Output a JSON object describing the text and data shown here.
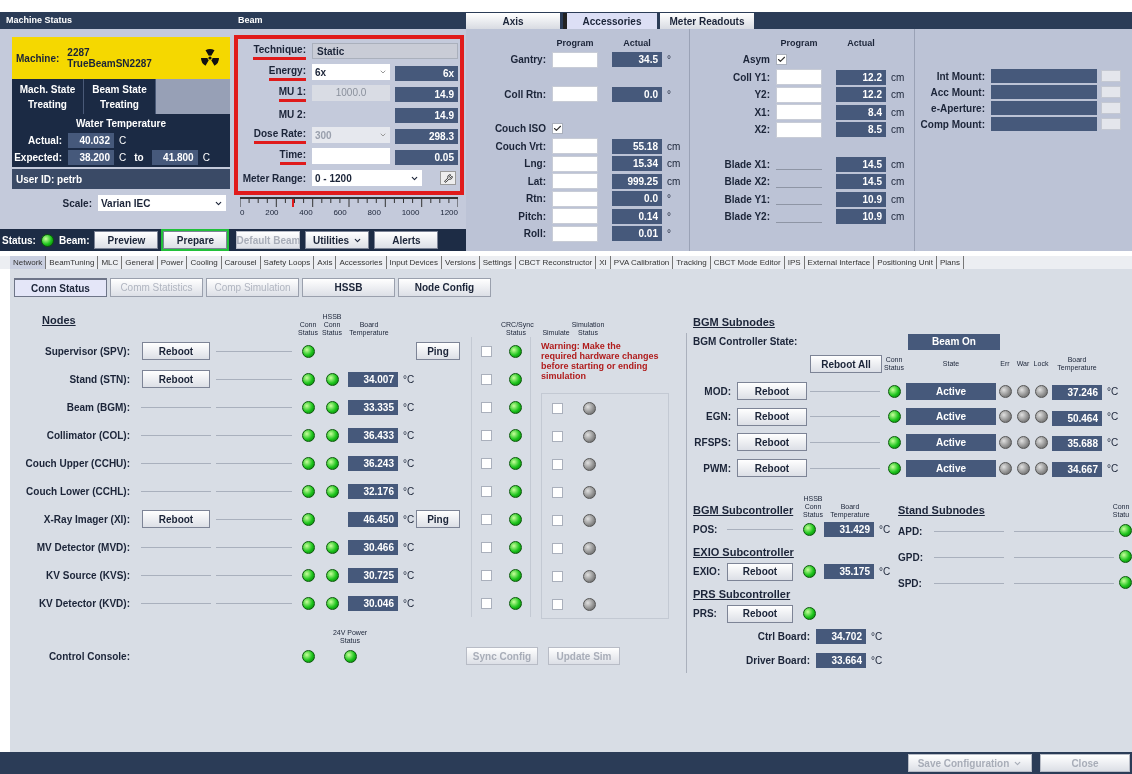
{
  "header": {
    "machine_status_title": "Machine Status",
    "beam_title": "Beam",
    "tabs": [
      {
        "label": "Axis",
        "selected": false
      },
      {
        "label": "Accessories",
        "selected": true
      },
      {
        "label": "Meter Readouts",
        "selected": false
      }
    ]
  },
  "machine": {
    "label": "Machine:",
    "number": "2287",
    "name": "TrueBeamSN2287",
    "states": [
      {
        "label": "Mach. State",
        "value": "Treating"
      },
      {
        "label": "Beam State",
        "value": "Treating"
      }
    ],
    "water": {
      "title": "Water Temperature",
      "actual_label": "Actual:",
      "actual": "40.032",
      "actual_unit": "C",
      "expected_label": "Expected:",
      "expected_min": "38.200",
      "min_unit": "C",
      "to": "to",
      "expected_max": "41.800",
      "max_unit": "C"
    },
    "user_id": "User ID: petrb",
    "scale_label": "Scale:",
    "scale": "Varian IEC"
  },
  "status_row": {
    "status_label": "Status:",
    "status_on": true,
    "beam_label": "Beam:",
    "buttons": [
      {
        "label": "Preview",
        "kind": "plain",
        "disabled": false,
        "highlighted": false
      },
      {
        "label": "Prepare",
        "kind": "plain",
        "disabled": false,
        "highlighted": true
      },
      {
        "label": "Default Beam",
        "kind": "plain",
        "disabled": true,
        "highlighted": false
      },
      {
        "label": "Utilities",
        "kind": "menu",
        "disabled": false,
        "highlighted": false
      },
      {
        "label": "Alerts",
        "kind": "plain",
        "disabled": false,
        "highlighted": false
      }
    ]
  },
  "beam": {
    "rows": [
      {
        "kind": "display",
        "label": "Technique:",
        "value": "Static",
        "marked": true
      },
      {
        "kind": "dropdown",
        "label": "Energy:",
        "value": "6x",
        "disabled": false,
        "actual": "6x",
        "marked": true
      },
      {
        "kind": "field",
        "label": "MU 1:",
        "value": "1000.0",
        "disabled": true,
        "actual": "14.9",
        "marked": true
      },
      {
        "kind": "readout",
        "label": "MU 2:",
        "actual": "14.9",
        "marked": false
      },
      {
        "kind": "dropdown",
        "label": "Dose Rate:",
        "value": "300",
        "disabled": true,
        "actual": "298.3",
        "marked": true
      },
      {
        "kind": "field",
        "label": "Time:",
        "disabled": false,
        "actual": "0.05",
        "marked": true
      }
    ],
    "meter_label": "Meter Range:",
    "meter_range": "0 - 1200",
    "meter": {
      "ticks": [
        "0",
        "200",
        "400",
        "600",
        "800",
        "1000",
        "1200"
      ],
      "level": 0.24
    }
  },
  "axis": {
    "left": {
      "program_header": "Program",
      "actual_header": "Actual",
      "groups": [
        [
          {
            "kind": "input",
            "label": "Gantry:",
            "actual": "34.5",
            "unit": "°"
          }
        ],
        [
          {
            "kind": "input",
            "label": "Coll Rtn:",
            "actual": "0.0",
            "unit": "°"
          }
        ],
        [
          {
            "kind": "checkbox",
            "label": "Couch ISO",
            "checked": true
          },
          {
            "kind": "input",
            "label": "Couch Vrt:",
            "actual": "55.18",
            "unit": "cm"
          },
          {
            "kind": "input",
            "label": "Lng:",
            "actual": "15.34",
            "unit": "cm"
          },
          {
            "kind": "input",
            "label": "Lat:",
            "actual": "999.25",
            "unit": "cm"
          },
          {
            "kind": "input",
            "label": "Rtn:",
            "actual": "0.0",
            "unit": "°"
          },
          {
            "kind": "input",
            "label": "Pitch:",
            "actual": "0.14",
            "unit": "°"
          },
          {
            "kind": "input",
            "label": "Roll:",
            "actual": "0.01",
            "unit": "°"
          }
        ]
      ]
    },
    "middle": {
      "program_header": "Program",
      "actual_header": "Actual",
      "groups": [
        [
          {
            "kind": "checkbox",
            "label": "Asym",
            "checked": true
          },
          {
            "kind": "input",
            "label": "Coll Y1:",
            "actual": "12.2",
            "unit": "cm"
          },
          {
            "kind": "input",
            "label": "Y2:",
            "actual": "12.2",
            "unit": "cm"
          },
          {
            "kind": "input",
            "label": "X1:",
            "actual": "8.4",
            "unit": "cm"
          },
          {
            "kind": "input",
            "label": "X2:",
            "actual": "8.5",
            "unit": "cm"
          }
        ],
        [
          {
            "kind": "line",
            "label": "Blade X1:",
            "actual": "14.5",
            "unit": "cm"
          },
          {
            "kind": "line",
            "label": "Blade X2:",
            "actual": "14.5",
            "unit": "cm"
          },
          {
            "kind": "line",
            "label": "Blade Y1:",
            "actual": "10.9",
            "unit": "cm"
          },
          {
            "kind": "line",
            "label": "Blade Y2:",
            "actual": "10.9",
            "unit": "cm"
          }
        ]
      ]
    },
    "mounts": [
      {
        "label": "Int Mount:"
      },
      {
        "label": "Acc Mount:"
      },
      {
        "label": "e-Aperture:"
      },
      {
        "label": "Comp Mount:"
      }
    ]
  },
  "tabs": [
    {
      "label": "Network",
      "selected": true
    },
    {
      "label": "BeamTuning",
      "selected": false
    },
    {
      "label": "MLC",
      "selected": false
    },
    {
      "label": "General",
      "selected": false
    },
    {
      "label": "Power",
      "selected": false
    },
    {
      "label": "Cooling",
      "selected": false
    },
    {
      "label": "Carousel",
      "selected": false
    },
    {
      "label": "Safety Loops",
      "selected": false
    },
    {
      "label": "Axis",
      "selected": false
    },
    {
      "label": "Accessories",
      "selected": false
    },
    {
      "label": "Input Devices",
      "selected": false
    },
    {
      "label": "Versions",
      "selected": false
    },
    {
      "label": "Settings",
      "selected": false
    },
    {
      "label": "CBCT Reconstructor",
      "selected": false
    },
    {
      "label": "XI",
      "selected": false
    },
    {
      "label": "PVA Calibration",
      "selected": false
    },
    {
      "label": "Tracking",
      "selected": false
    },
    {
      "label": "CBCT Mode Editor",
      "selected": false
    },
    {
      "label": "IPS",
      "selected": false
    },
    {
      "label": "External Interface",
      "selected": false
    },
    {
      "label": "Positioning Unit",
      "selected": false
    },
    {
      "label": "Plans",
      "selected": false
    }
  ],
  "subtabs": [
    {
      "label": "Conn Status",
      "selected": true,
      "disabled": false
    },
    {
      "label": "Comm Statistics",
      "selected": false,
      "disabled": true
    },
    {
      "label": "Comp Simulation",
      "selected": false,
      "disabled": true
    },
    {
      "label": "HSSB",
      "selected": false,
      "disabled": false
    },
    {
      "label": "Node Config",
      "selected": false,
      "disabled": false
    }
  ],
  "nodes": {
    "title": "Nodes",
    "headers": {
      "conn": "Conn Status",
      "hssb": "HSSB Conn Status",
      "temp": "Board Temperature",
      "crc": "CRC/Sync Status"
    },
    "rows": [
      {
        "name": "Supervisor (SPV):",
        "reboot": "Reboot",
        "conn_on": true,
        "ping": "Ping",
        "crc_checked": false,
        "crc_on": true
      },
      {
        "name": "Stand (STN):",
        "reboot": "Reboot",
        "conn_on": true,
        "hssb_on": true,
        "temp": "34.007",
        "unit": "°C",
        "crc_checked": false,
        "crc_on": true
      },
      {
        "name": "Beam (BGM):",
        "conn_on": true,
        "hssb_on": true,
        "temp": "33.335",
        "unit": "°C",
        "crc_checked": false,
        "crc_on": true
      },
      {
        "name": "Collimator (COL):",
        "conn_on": true,
        "hssb_on": true,
        "temp": "36.433",
        "unit": "°C",
        "crc_checked": false,
        "crc_on": true
      },
      {
        "name": "Couch Upper (CCHU):",
        "conn_on": true,
        "hssb_on": true,
        "temp": "36.243",
        "unit": "°C",
        "crc_checked": false,
        "crc_on": true
      },
      {
        "name": "Couch Lower (CCHL):",
        "conn_on": true,
        "hssb_on": true,
        "temp": "32.176",
        "unit": "°C",
        "crc_checked": false,
        "crc_on": true
      },
      {
        "name": "X-Ray Imager (XI):",
        "reboot": "Reboot",
        "conn_on": true,
        "temp": "46.450",
        "unit": "°C",
        "ping": "Ping",
        "crc_checked": false,
        "crc_on": true
      },
      {
        "name": "MV Detector (MVD):",
        "conn_on": true,
        "hssb_on": true,
        "temp": "30.466",
        "unit": "°C",
        "crc_checked": false,
        "crc_on": true
      },
      {
        "name": "KV Source (KVS):",
        "conn_on": true,
        "hssb_on": true,
        "temp": "30.725",
        "unit": "°C",
        "crc_checked": false,
        "crc_on": true
      },
      {
        "name": "KV Detector (KVD):",
        "conn_on": true,
        "hssb_on": true,
        "temp": "30.046",
        "unit": "°C",
        "crc_checked": false,
        "crc_on": true
      }
    ],
    "console": {
      "name": "Control Console:",
      "conn_on": true,
      "power_header": "24V Power Status",
      "power_on": true
    }
  },
  "simulation": {
    "headers": {
      "simulate": "Simulate",
      "status": "Simulation Status"
    },
    "warning": "Warning: Make the required hardware changes before starting or ending simulation",
    "rows": [
      {
        "checked": false,
        "on": false
      },
      {
        "checked": false,
        "on": false
      },
      {
        "checked": false,
        "on": false
      },
      {
        "checked": false,
        "on": false
      },
      {
        "checked": false,
        "on": false
      },
      {
        "checked": false,
        "on": false
      },
      {
        "checked": false,
        "on": false
      },
      {
        "checked": false,
        "on": false
      }
    ],
    "buttons": [
      {
        "label": "Sync Config",
        "disabled": true
      },
      {
        "label": "Update Sim",
        "disabled": true
      }
    ]
  },
  "bgm": {
    "title": "BGM Subnodes",
    "controller_label": "BGM Controller State:",
    "controller_state": "Beam On",
    "reboot_all": "Reboot All",
    "headers": {
      "conn": "Conn Status",
      "state": "State",
      "err": "Err",
      "war": "War",
      "lock": "Lock",
      "temp": "Board Temperature"
    },
    "rows": [
      {
        "name": "MOD:",
        "reboot": "Reboot",
        "conn_on": true,
        "state": "Active",
        "err_on": false,
        "war_on": false,
        "lock_on": false,
        "temp": "37.246",
        "unit": "°C"
      },
      {
        "name": "EGN:",
        "reboot": "Reboot",
        "conn_on": true,
        "state": "Active",
        "err_on": false,
        "war_on": false,
        "lock_on": false,
        "temp": "50.464",
        "unit": "°C"
      },
      {
        "name": "RFSPS:",
        "reboot": "Reboot",
        "conn_on": true,
        "state": "Active",
        "err_on": false,
        "war_on": false,
        "lock_on": false,
        "temp": "35.688",
        "unit": "°C"
      },
      {
        "name": "PWM:",
        "reboot": "Reboot",
        "conn_on": true,
        "state": "Active",
        "err_on": false,
        "war_on": false,
        "lock_on": false,
        "temp": "34.667",
        "unit": "°C"
      }
    ]
  },
  "subcontrollers": [
    {
      "title": "BGM Subcontroller",
      "hssb_header": "HSSB Conn Status",
      "temp_header": "Board Temperature",
      "rows": [
        {
          "name": "POS:",
          "conn_on": true,
          "temp": "31.429",
          "unit": "°C"
        }
      ]
    },
    {
      "title": "EXIO Subcontroller",
      "rows": [
        {
          "name": "EXIO:",
          "reboot": "Reboot",
          "conn_on": true,
          "temp": "35.175",
          "unit": "°C"
        }
      ]
    },
    {
      "title": "PRS Subcontroller",
      "rows": [
        {
          "name": "PRS:",
          "reboot": "Reboot",
          "conn_on": true
        }
      ],
      "boards": [
        {
          "label": "Ctrl Board:",
          "temp": "34.702",
          "unit": "°C"
        },
        {
          "label": "Driver Board:",
          "temp": "33.664",
          "unit": "°C"
        }
      ]
    }
  ],
  "stand": {
    "title": "Stand Subnodes",
    "conn_header": "Conn Statu",
    "rows": [
      {
        "name": "APD:",
        "conn_on": true
      },
      {
        "name": "GPD:",
        "conn_on": true
      },
      {
        "name": "SPD:",
        "conn_on": true
      }
    ]
  },
  "footer": {
    "buttons": [
      {
        "label": "Save Configuration",
        "kind": "menu",
        "disabled": true
      },
      {
        "label": "Close",
        "kind": "plain",
        "disabled": true
      }
    ]
  }
}
